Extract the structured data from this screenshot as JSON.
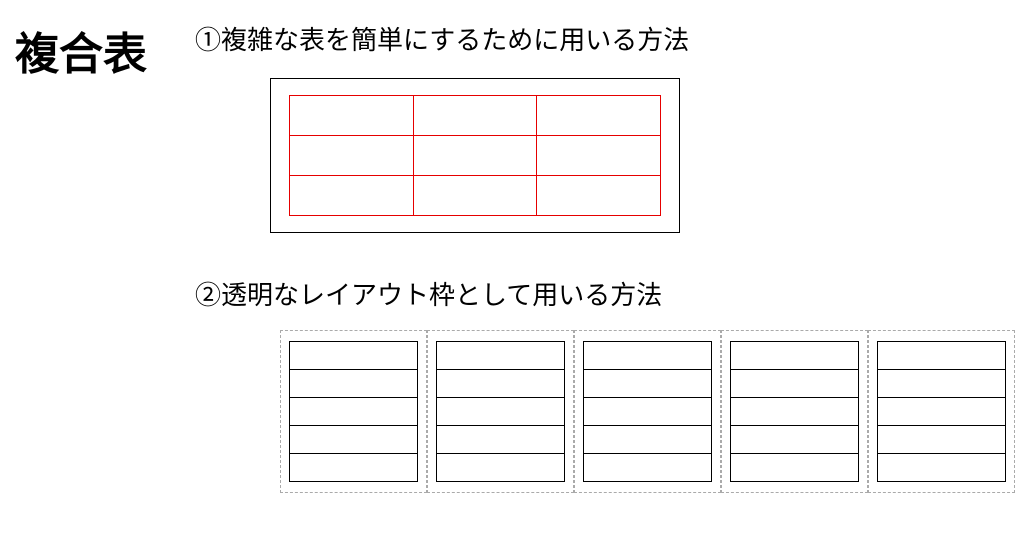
{
  "title": "複合表",
  "description_1": "①複雑な表を簡単にするために用いる方法",
  "description_2": "②透明なレイアウト枠として用いる方法",
  "example_1": {
    "inner_rows": 3,
    "inner_cols": 3,
    "inner_border_color": "#e60000",
    "outer_border_color": "#000000"
  },
  "example_2": {
    "outer_cells": 5,
    "inner_rows_per_cell": 5,
    "inner_cols_per_cell": 1,
    "outer_border_style": "dashed",
    "inner_border_style": "solid"
  }
}
